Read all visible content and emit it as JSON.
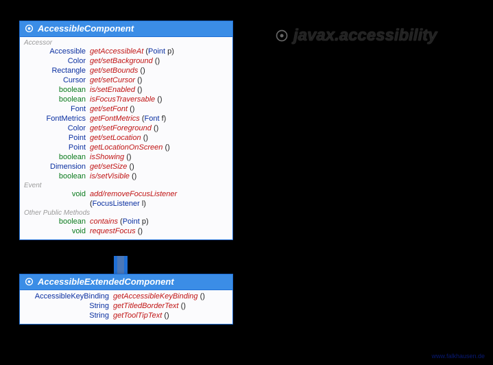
{
  "package_title": "javax.accessibility",
  "watermark": "www.falkhausen.de",
  "classes": {
    "comp": {
      "name": "AccessibleComponent",
      "sections": [
        {
          "label": "Accessor",
          "methods": [
            {
              "ret": "Accessible",
              "retKind": "type",
              "name": "getAccessibleAt",
              "params": "(Point p)"
            },
            {
              "ret": "Color",
              "retKind": "type",
              "name": "get/setBackground",
              "params": "()"
            },
            {
              "ret": "Rectangle",
              "retKind": "type",
              "name": "get/setBounds",
              "params": "()"
            },
            {
              "ret": "Cursor",
              "retKind": "type",
              "name": "get/setCursor",
              "params": "()"
            },
            {
              "ret": "boolean",
              "retKind": "kw",
              "name": "is/setEnabled",
              "params": "()"
            },
            {
              "ret": "boolean",
              "retKind": "kw",
              "name": "isFocusTraversable",
              "params": "()"
            },
            {
              "ret": "Font",
              "retKind": "type",
              "name": "get/setFont",
              "params": "()"
            },
            {
              "ret": "FontMetrics",
              "retKind": "type",
              "name": "getFontMetrics",
              "params": "(Font f)"
            },
            {
              "ret": "Color",
              "retKind": "type",
              "name": "get/setForeground",
              "params": "()"
            },
            {
              "ret": "Point",
              "retKind": "type",
              "name": "get/setLocation",
              "params": "()"
            },
            {
              "ret": "Point",
              "retKind": "type",
              "name": "getLocationOnScreen",
              "params": "()"
            },
            {
              "ret": "boolean",
              "retKind": "kw",
              "name": "isShowing",
              "params": "()"
            },
            {
              "ret": "Dimension",
              "retKind": "type",
              "name": "get/setSize",
              "params": "()"
            },
            {
              "ret": "boolean",
              "retKind": "kw",
              "name": "is/setVisible",
              "params": "()"
            }
          ]
        },
        {
          "label": "Event",
          "methods": [
            {
              "ret": "void",
              "retKind": "kw",
              "name": "add/removeFocusListener",
              "params": "(FocusListener l)"
            }
          ]
        },
        {
          "label": "Other Public Methods",
          "methods": [
            {
              "ret": "boolean",
              "retKind": "kw",
              "name": "contains",
              "params": "(Point p)"
            },
            {
              "ret": "void",
              "retKind": "kw",
              "name": "requestFocus",
              "params": "()"
            }
          ]
        }
      ]
    },
    "ext": {
      "name": "AccessibleExtendedComponent",
      "sections": [
        {
          "label": "",
          "methods": [
            {
              "ret": "AccessibleKeyBinding",
              "retKind": "type",
              "name": "getAccessibleKeyBinding",
              "params": "()"
            },
            {
              "ret": "String",
              "retKind": "type",
              "name": "getTitledBorderText",
              "params": "()"
            },
            {
              "ret": "String",
              "retKind": "type",
              "name": "getToolTipText",
              "params": "()"
            }
          ]
        }
      ]
    }
  }
}
